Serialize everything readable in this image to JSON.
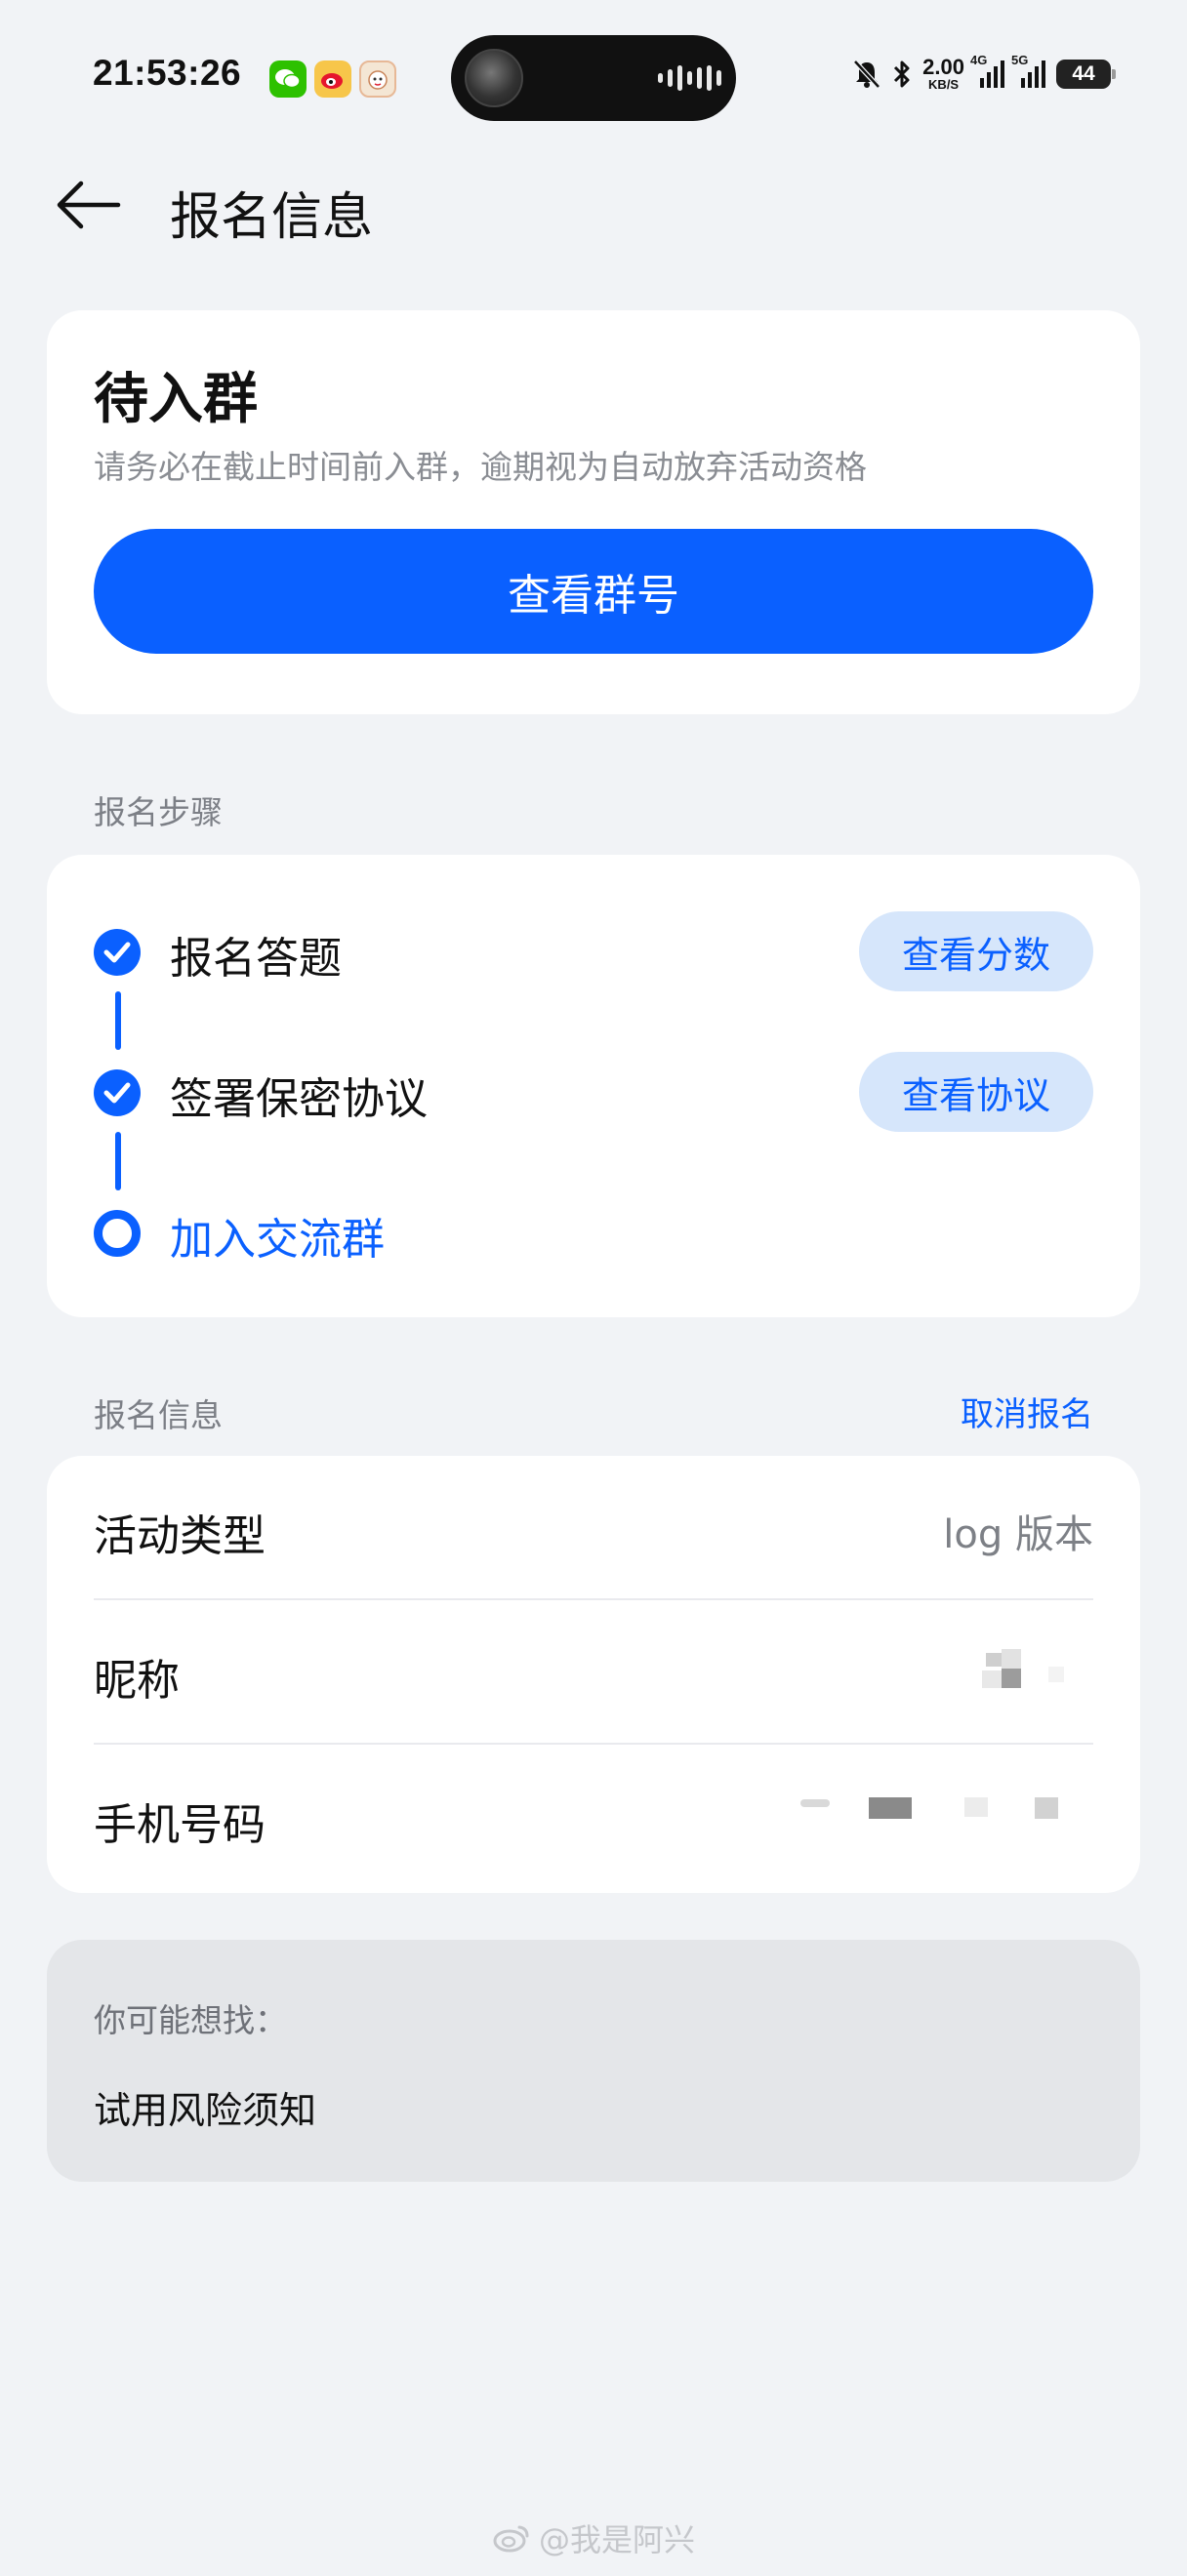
{
  "status_bar": {
    "time": "21:53:26",
    "net_speed_value": "2.00",
    "net_speed_unit": "KB/S",
    "network_1": "4G",
    "network_2": "5G",
    "battery": "44"
  },
  "header": {
    "title": "报名信息"
  },
  "status_card": {
    "title": "待入群",
    "description": "请务必在截止时间前入群，逾期视为自动放弃活动资格",
    "button_label": "查看群号"
  },
  "steps_section": {
    "label": "报名步骤",
    "steps": [
      {
        "label": "报名答题",
        "state": "done",
        "action": "查看分数"
      },
      {
        "label": "签署保密协议",
        "state": "done",
        "action": "查看协议"
      },
      {
        "label": "加入交流群",
        "state": "current"
      }
    ]
  },
  "info_section": {
    "label": "报名信息",
    "cancel_label": "取消报名",
    "rows": [
      {
        "label": "活动类型",
        "value": "log 版本"
      },
      {
        "label": "昵称"
      },
      {
        "label": "手机号码"
      }
    ]
  },
  "suggest": {
    "label": "你可能想找：",
    "link": "试用风险须知"
  },
  "watermark": "@我是阿兴",
  "colors": {
    "accent": "#0a60ff",
    "accent_soft": "#d6e6fb",
    "page_bg": "#f1f3f6",
    "muted_text": "#8a8d93"
  }
}
